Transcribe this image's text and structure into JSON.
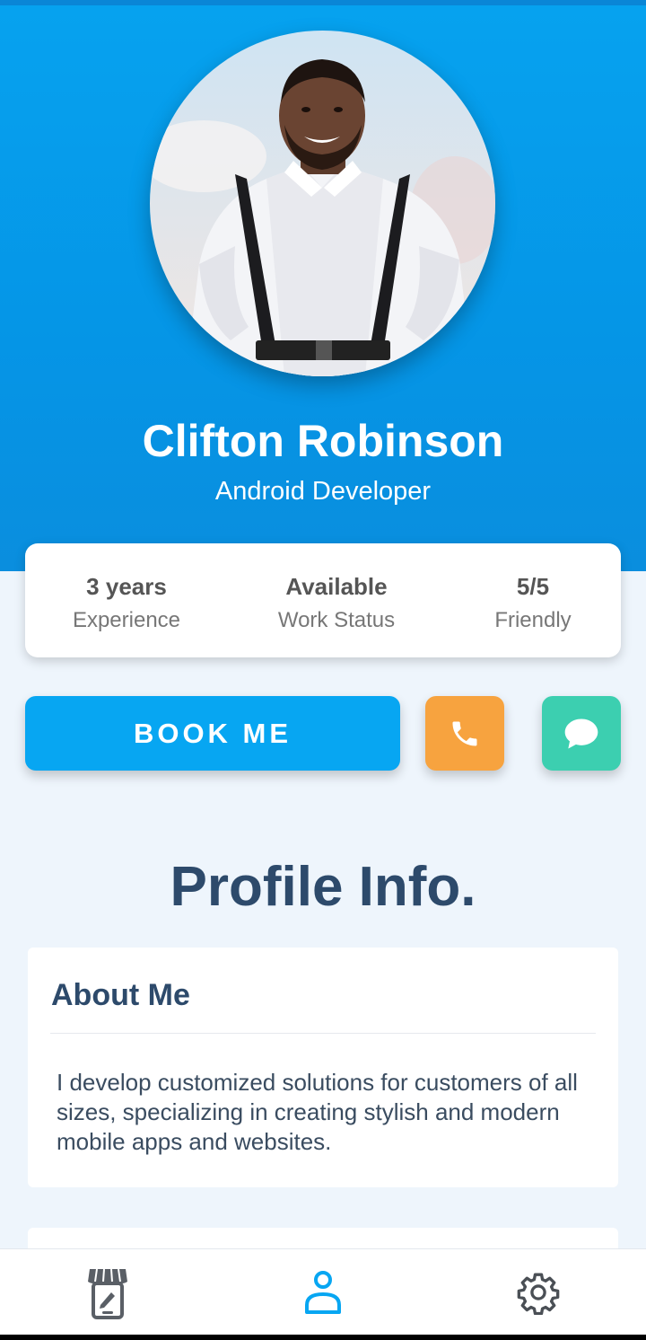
{
  "profile": {
    "name": "Clifton Robinson",
    "role": "Android Developer"
  },
  "stats": [
    {
      "value": "3 years",
      "label": "Experience"
    },
    {
      "value": "Available",
      "label": "Work Status"
    },
    {
      "value": "5/5",
      "label": "Friendly"
    }
  ],
  "actions": {
    "book_label": "BOOK ME",
    "call_icon": "phone-icon",
    "chat_icon": "chat-bubble-icon"
  },
  "section": {
    "title": "Profile Info."
  },
  "about": {
    "title": "About Me",
    "text": "I develop customized solutions for customers of all sizes, specializing in creating stylish and modern mobile apps and websites."
  },
  "bottom_nav": [
    {
      "icon": "store-icon",
      "active": false
    },
    {
      "icon": "user-icon",
      "active": true
    },
    {
      "icon": "gear-icon",
      "active": false
    }
  ],
  "colors": {
    "hero": "#06a2ef",
    "book": "#07a6f2",
    "call": "#f7a33f",
    "chat": "#3ccfb0",
    "heading": "#2d4a6b",
    "nav_active": "#07a6f2"
  }
}
